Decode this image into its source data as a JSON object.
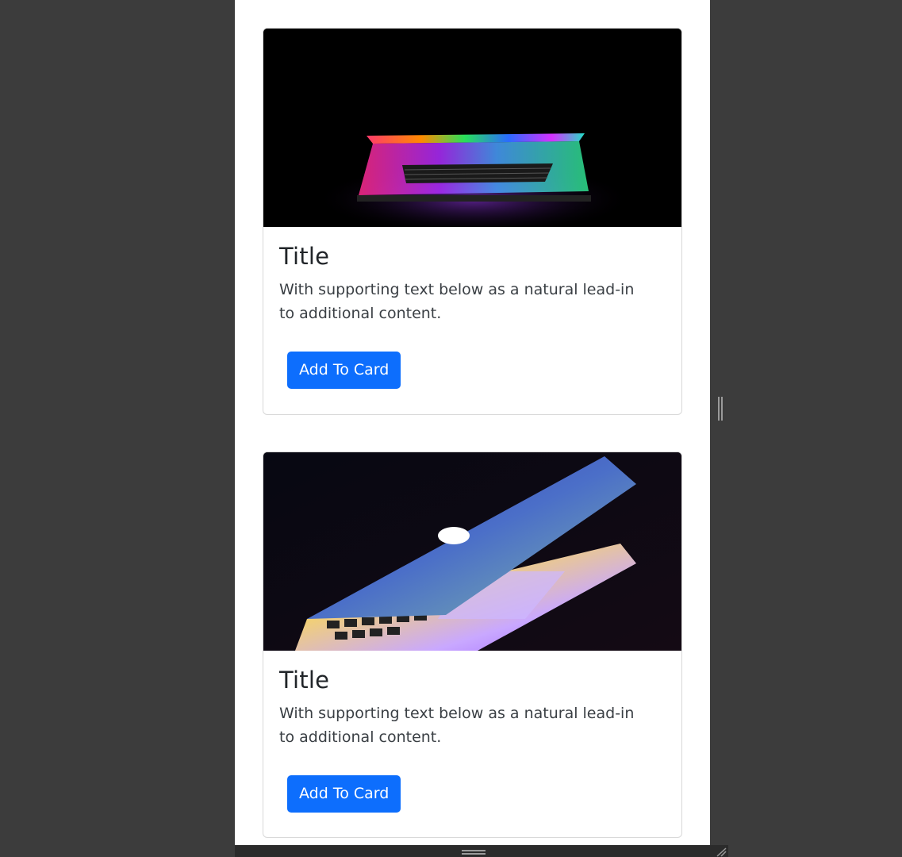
{
  "cards": [
    {
      "title": "Title",
      "text": "With supporting text below as a natural lead-in to additional content.",
      "button_label": "Add To Card"
    },
    {
      "title": "Title",
      "text": "With supporting text below as a natural lead-in to additional content.",
      "button_label": "Add To Card"
    }
  ],
  "colors": {
    "button": "#0d6efd",
    "background": "#3c3c3c",
    "page": "#ffffff"
  },
  "icons": {
    "vertical_splitter": "drag-handle-vertical-icon",
    "horizontal_splitter": "drag-handle-horizontal-icon",
    "resize": "resize-corner-icon"
  }
}
